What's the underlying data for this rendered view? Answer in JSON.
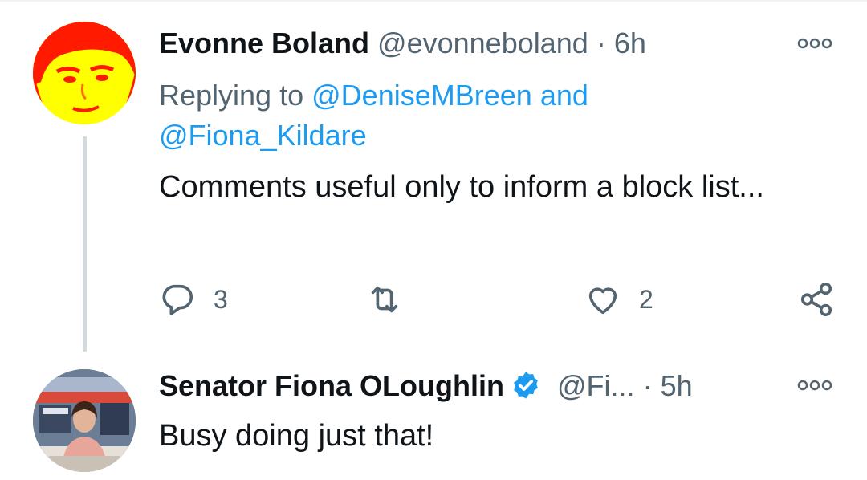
{
  "tweets": [
    {
      "author_name": "Evonne Boland",
      "handle": "@evonneboland",
      "separator": "·",
      "time": "6h",
      "reply_prefix": "Replying to",
      "reply_user1": "@DeniseMBreen",
      "reply_and": "and",
      "reply_user2": "@Fiona_Kildare",
      "text": "Comments useful only to inform a block list...",
      "reply_count": "3",
      "like_count": "2"
    },
    {
      "author_name": "Senator Fiona OLoughlin",
      "handle": "@Fi...",
      "separator": "·",
      "time": "5h",
      "verified": true,
      "text": "Busy doing just that!"
    }
  ],
  "colors": {
    "link": "#1d9bf0",
    "secondary_text": "#536471",
    "verified_badge": "#1d9bf0",
    "thread_line": "#cfd9de"
  },
  "icons": [
    "more-icon",
    "reply-icon",
    "retweet-icon",
    "like-icon",
    "share-icon",
    "verified-badge-icon"
  ]
}
